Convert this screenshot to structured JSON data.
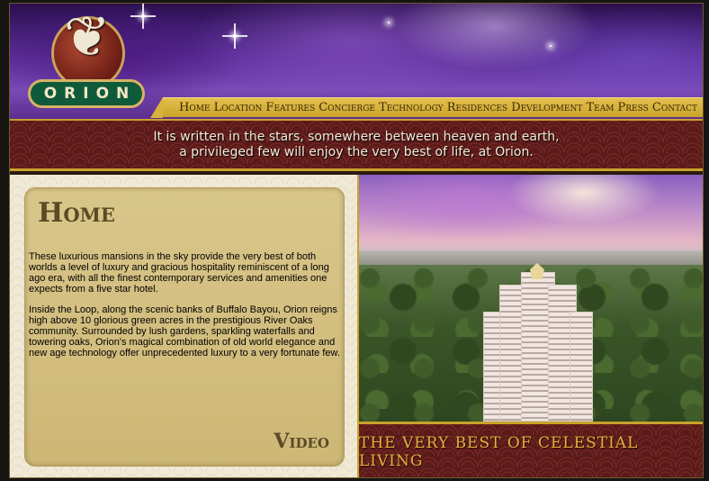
{
  "logo": {
    "text": "ORION"
  },
  "nav": {
    "items": [
      "Home",
      "Location",
      "Features",
      "Concierge",
      "Technology",
      "Residences",
      "Development Team",
      "Press",
      "Contact"
    ]
  },
  "tagline": {
    "line1": "It is written in the stars, somewhere between heaven and earth,",
    "line2": "a privileged few will enjoy the very best of life, at Orion."
  },
  "main": {
    "title": "Home",
    "paragraph1": "These luxurious mansions in the sky provide the very best of both worlds a level of luxury and gracious hospitality reminiscent of a long ago era, with all the finest contemporary services and amenities one expects from a five star hotel.",
    "paragraph2": "Inside the Loop, along the scenic banks of Buffalo Bayou, Orion reigns high above 10 glorious green acres in the prestigious River Oaks community. Surrounded by lush gardens, sparkling waterfalls and towering oaks, Orion's magical combination of old world elegance and new age technology offer unprecedented luxury to a very fortunate few.",
    "video_label": "Video"
  },
  "banner": {
    "text": "THE VERY BEST OF CELESTIAL LIVING"
  },
  "colors": {
    "gold": "#c9a22b",
    "maroon": "#5b1a1a",
    "purple": "#5a2d97",
    "logo_green": "#0f5a3a"
  }
}
